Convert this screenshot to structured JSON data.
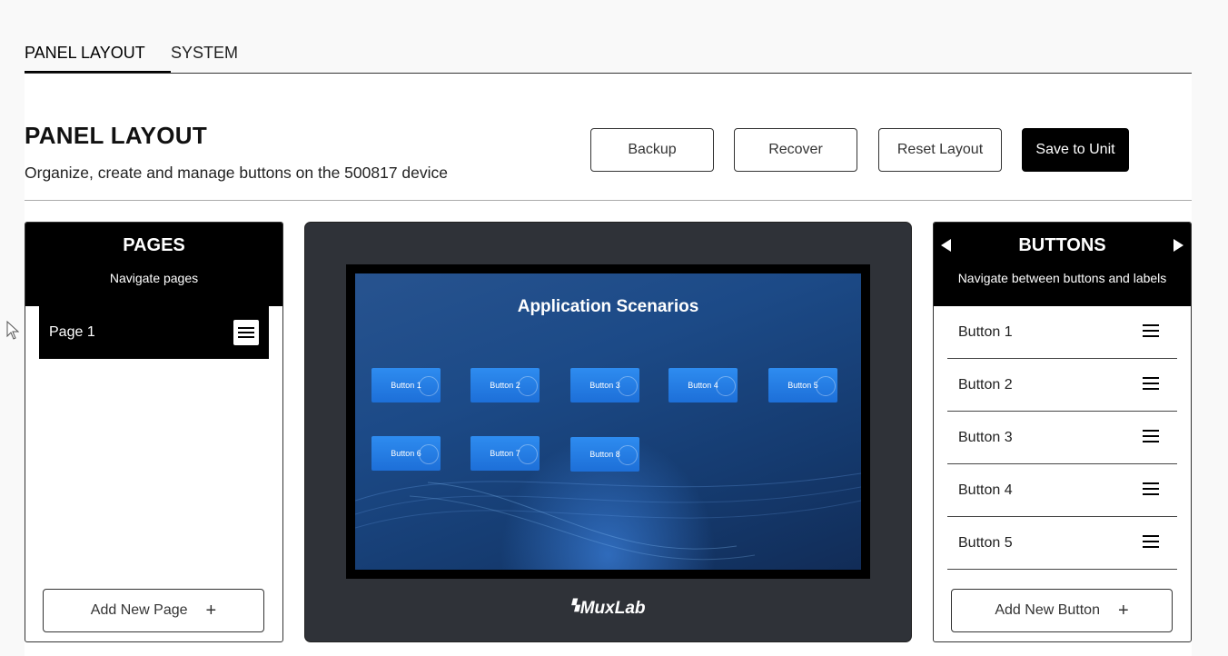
{
  "tabs": [
    {
      "label": "PANEL LAYOUT",
      "active": true
    },
    {
      "label": "SYSTEM",
      "active": false
    }
  ],
  "header": {
    "title": "PANEL LAYOUT",
    "subtitle": "Organize, create and manage buttons on the 500817 device",
    "actions": {
      "backup": "Backup",
      "recover": "Recover",
      "reset": "Reset Layout",
      "save": "Save to Unit"
    }
  },
  "pages_panel": {
    "title": "PAGES",
    "subtitle": "Navigate pages",
    "pages": [
      "Page 1"
    ],
    "add_label": "Add New Page",
    "add_icon": "+"
  },
  "device": {
    "screen_title": "Application Scenarios",
    "buttons": [
      "Button 1",
      "Button 2",
      "Button 3",
      "Button 4",
      "Button 5",
      "Button 6",
      "Button 7",
      "Button 8"
    ],
    "brand": "MuxLab",
    "colors": {
      "screen": "#1c4a87",
      "button": "#2e8cf0",
      "bezel": "#2f3238"
    }
  },
  "buttons_panel": {
    "title": "BUTTONS",
    "subtitle": "Navigate between buttons and labels",
    "items": [
      "Button 1",
      "Button 2",
      "Button 3",
      "Button 4",
      "Button 5"
    ],
    "add_label": "Add New Button",
    "add_icon": "+"
  }
}
